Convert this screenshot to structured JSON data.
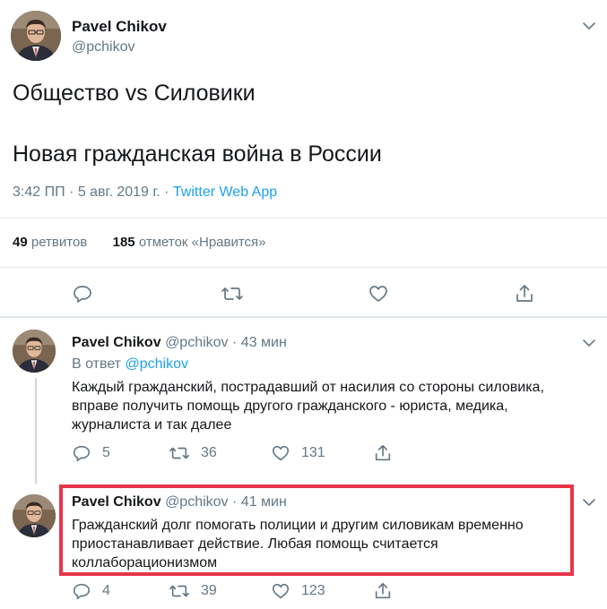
{
  "main_tweet": {
    "author_name": "Pavel Chikov",
    "author_handle": "@pchikov",
    "line1": "Общество vs Силовики",
    "line2": "Новая гражданская война в России",
    "time": "3:42 ПП",
    "separator": " · ",
    "date": "5 авг. 2019 г.",
    "app": "Twitter Web App",
    "retweets_count": "49",
    "retweets_label": "ретвитов",
    "likes_count": "185",
    "likes_label": "отметок «Нравится»"
  },
  "replies": [
    {
      "author_name": "Pavel Chikov",
      "author_handle": "@pchikov",
      "time": "43 мин",
      "reply_prefix": "В ответ",
      "reply_mention": "@pchikov",
      "line1": "Каждый гражданский, пострадавший от насилия со стороны силовика,",
      "line2": "вправе получить помощь другого гражданского - юриста, медика,",
      "line3": "журналиста и так далее",
      "replies_count": "5",
      "retweets_count": "36",
      "likes_count": "131"
    },
    {
      "author_name": "Pavel Chikov",
      "author_handle": "@pchikov",
      "time": "41 мин",
      "line1": "Гражданский долг помогать полиции и другим силовикам временно",
      "line2": "приостанавливает действие. Любая помощь считается",
      "line3": "коллаборационизмом",
      "replies_count": "4",
      "retweets_count": "39",
      "likes_count": "123"
    }
  ],
  "colors": {
    "accent": "#1da1f2",
    "text": "#14171a",
    "secondary": "#657786",
    "highlight_border": "#e8354a"
  },
  "icons": [
    "chevron-down-icon",
    "reply-icon",
    "retweet-icon",
    "like-icon",
    "share-icon"
  ]
}
